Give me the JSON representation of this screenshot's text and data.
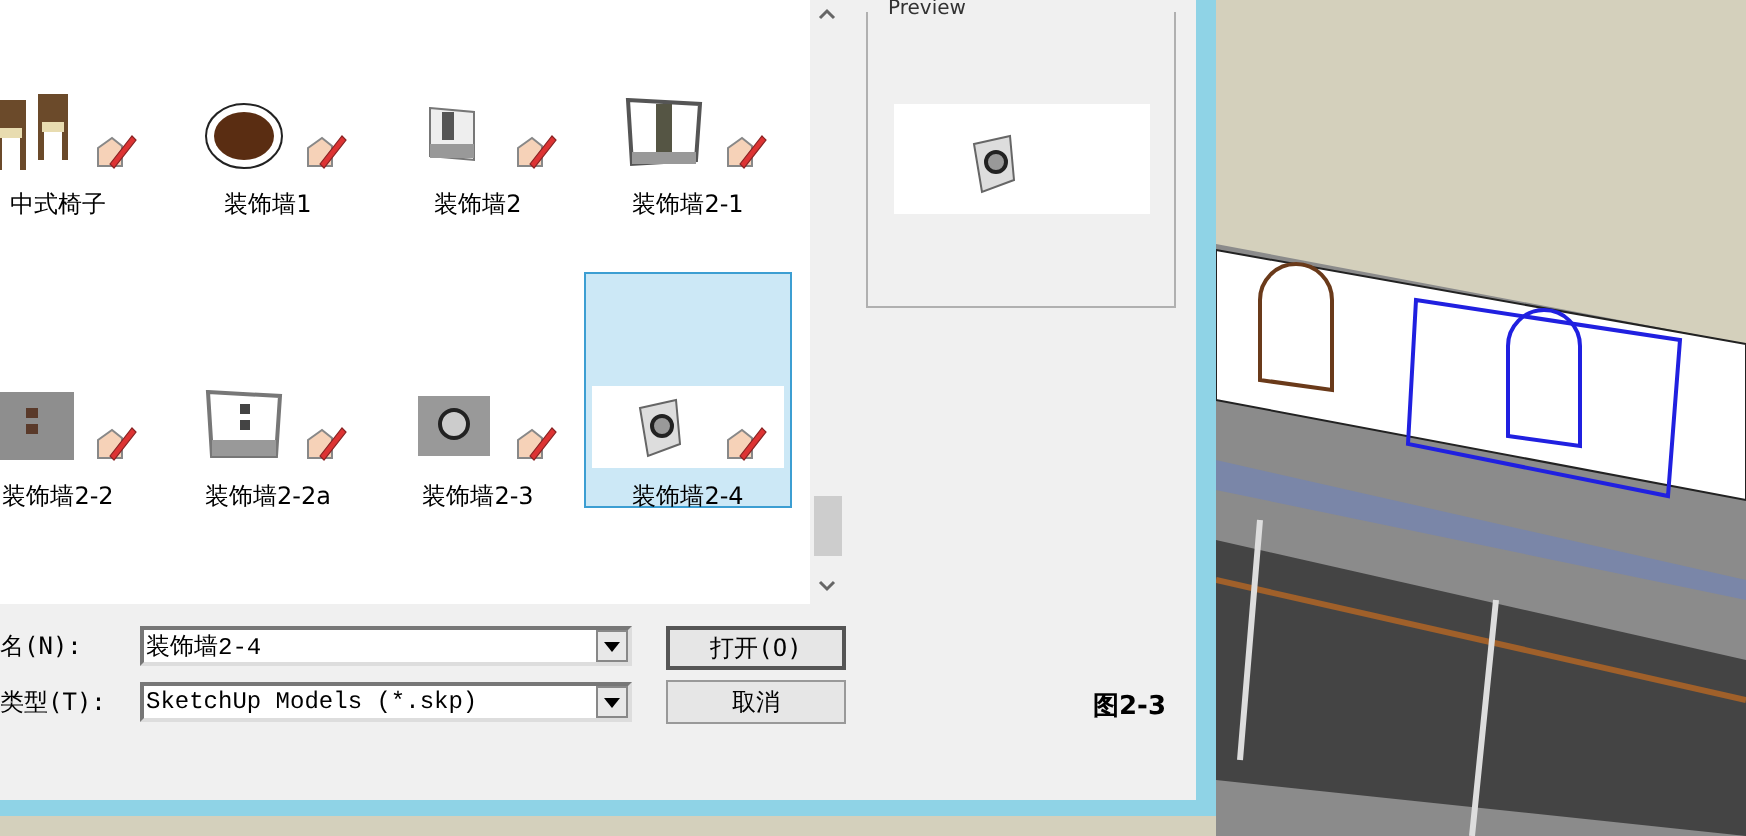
{
  "files": {
    "items": [
      {
        "name": "中式椅子",
        "kind": "chairs",
        "selected": false
      },
      {
        "name": "装饰墙1",
        "kind": "round",
        "selected": false
      },
      {
        "name": "装饰墙2",
        "kind": "narrow",
        "selected": false
      },
      {
        "name": "装饰墙2-1",
        "kind": "frame",
        "selected": false
      },
      {
        "name": "装饰墙2-2",
        "kind": "stone",
        "selected": false
      },
      {
        "name": "装饰墙2-2a",
        "kind": "white",
        "selected": false
      },
      {
        "name": "装饰墙2-3",
        "kind": "circle",
        "selected": false
      },
      {
        "name": "装饰墙2-4",
        "kind": "tilted",
        "selected": true
      }
    ]
  },
  "preview": {
    "label": "Preview"
  },
  "filename": {
    "label": "名(N):",
    "value": "装饰墙2-4"
  },
  "filetype": {
    "label": "类型(T):",
    "value": "SketchUp Models (*.skp)"
  },
  "buttons": [
    "打开(O)",
    "取消"
  ],
  "caption": "图2-3"
}
